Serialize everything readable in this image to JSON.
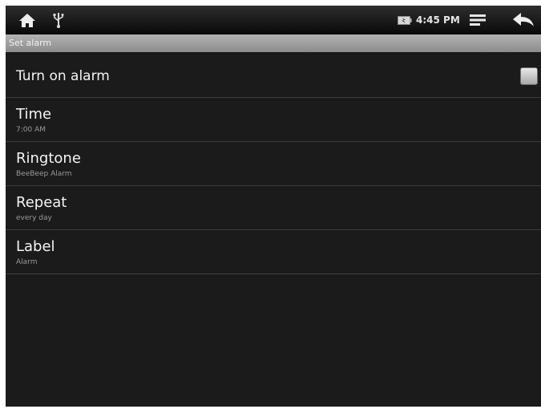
{
  "status_bar": {
    "time": "4:45 PM",
    "icons": [
      "home-icon",
      "usb-icon",
      "battery-icon",
      "menu-icon",
      "back-icon"
    ]
  },
  "title_bar": {
    "title": "Set alarm"
  },
  "settings": {
    "turn_on_alarm": {
      "label": "Turn on alarm",
      "checked": false
    },
    "time": {
      "label": "Time",
      "value": "7:00 AM"
    },
    "ringtone": {
      "label": "Ringtone",
      "value": "BeeBeep Alarm"
    },
    "repeat": {
      "label": "Repeat",
      "value": "every day"
    },
    "label": {
      "label": "Label",
      "value": "Alarm"
    }
  },
  "colors": {
    "background": "#1b1b1b",
    "divider": "#3c3c3c",
    "title_bar": "#a0a0a0",
    "primary_text": "#f4f4f4",
    "secondary_text": "#9a9a9a"
  }
}
